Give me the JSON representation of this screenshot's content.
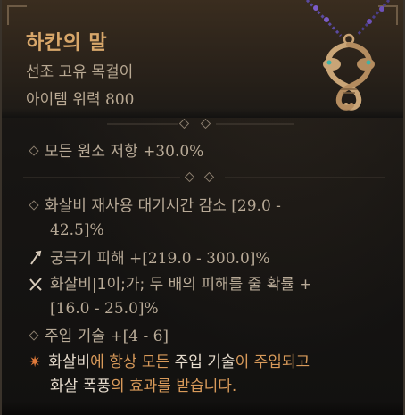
{
  "item": {
    "name": "하칸의 말",
    "type": "선조 고유 목걸이",
    "power_label": "아이템 위력 ",
    "power_value": "800"
  },
  "stats": {
    "resist": {
      "text": "모든 원소 저항 ",
      "value": "+30.0%"
    },
    "cooldown": {
      "line1_text": "화살비 재사용 대기시간 감소 ",
      "line1_value": "[29.0 -",
      "line2_value": "42.5]%"
    },
    "ultimate": {
      "text": "궁극기 피해 ",
      "value": "+[219.0 - 300.0]%"
    },
    "double_damage": {
      "line1_text": "화살비|1이;가; 두 배의 피해를 줄 확률 +",
      "line2_value": "[16.0 - 25.0]%"
    },
    "imbue": {
      "text": "주입 기술 ",
      "value": "+[4 - 6]"
    }
  },
  "unique": {
    "part1": "화살비",
    "part2": "에 항상 모든 ",
    "part3": "주입 기술",
    "part4": "이 주입되고",
    "part5": "화살 폭풍",
    "part6": "의 효과를 받습니다."
  },
  "icons": {
    "amulet": "serpent-amulet-icon",
    "bullet": "diamond-bullet-icon",
    "ultimate": "arrow-up-icon",
    "swap": "swap-arrows-icon",
    "unique": "starburst-icon"
  },
  "colors": {
    "title": "#d8a76a",
    "highlight": "#d89a5a",
    "text": "#b8aa97"
  }
}
